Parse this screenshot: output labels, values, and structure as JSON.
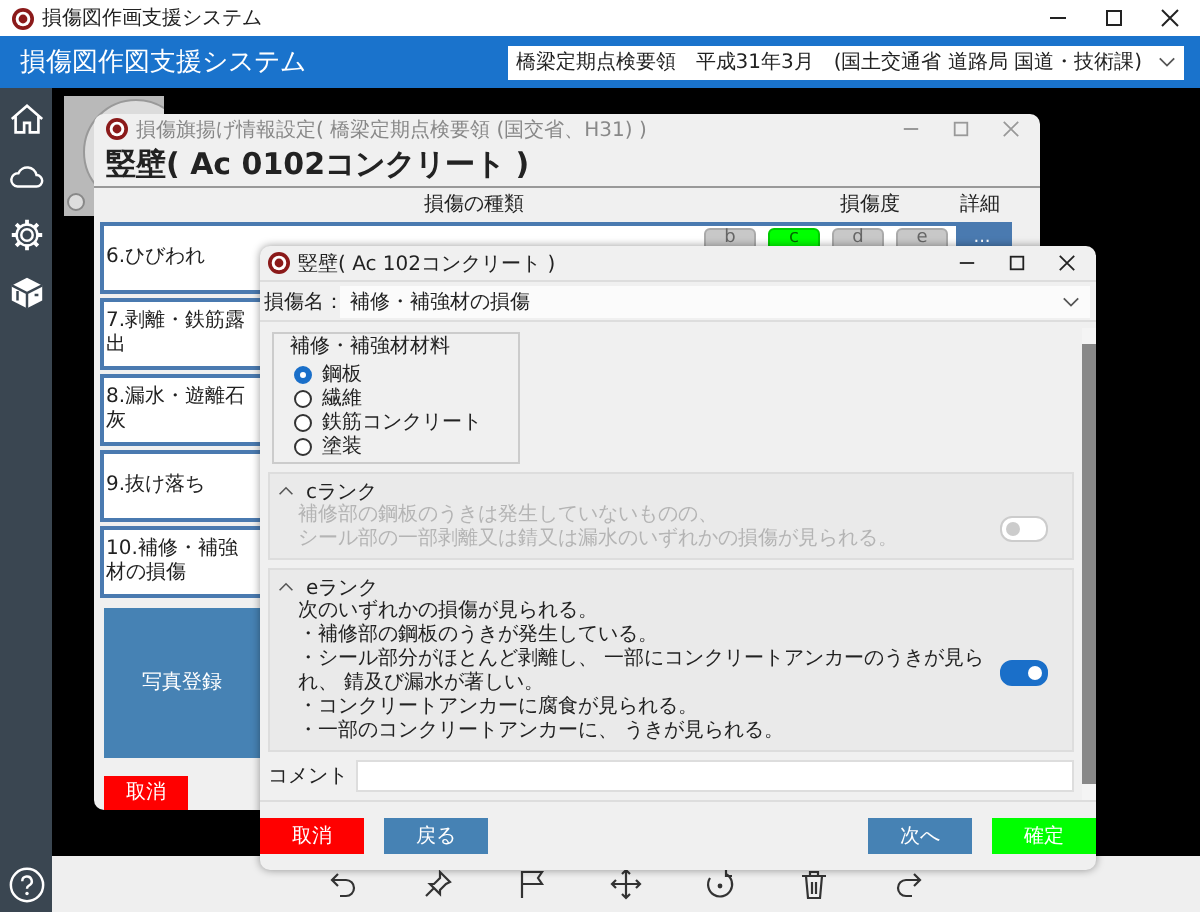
{
  "app_window": {
    "title": "損傷図作画支援システム"
  },
  "header": {
    "title": "損傷図作図支援システム",
    "standard": "橋梁定期点検要領　平成31年3月　(国土交通省 道路局 国道・技術課)"
  },
  "damage_window": {
    "title": "損傷旗揚げ情報設定( 橋梁定期点検要領 (国交省、H31) )",
    "heading": "竪壁( Ac 0102コンクリート )",
    "columns": [
      "損傷の種類",
      "損傷度",
      "詳細"
    ],
    "rows": [
      {
        "label": "6.ひびわれ",
        "ranks": [
          {
            "label": "b",
            "selected": false
          },
          {
            "label": "c",
            "selected": true
          },
          {
            "label": "d",
            "selected": false
          },
          {
            "label": "e",
            "selected": false
          }
        ],
        "detail": "..."
      },
      {
        "label": "7.剥離・鉄筋露出"
      },
      {
        "label": "8.漏水・遊離石灰"
      },
      {
        "label": "9.抜け落ち"
      },
      {
        "label": "10.補修・補強材の損傷"
      }
    ],
    "photo_button": "写真登録",
    "cancel_button": "取消"
  },
  "dialog": {
    "title": "竪壁( Ac  102コンクリート )",
    "damage_name": {
      "label": "損傷名：",
      "value": "補修・補強材の損傷"
    },
    "material": {
      "legend": "補修・補強材材料",
      "options": [
        {
          "label": "鋼板",
          "selected": true
        },
        {
          "label": "繊維",
          "selected": false
        },
        {
          "label": "鉄筋コンクリート",
          "selected": false
        },
        {
          "label": "塗装",
          "selected": false
        }
      ]
    },
    "ranks": [
      {
        "name": "cランク",
        "enabled": false,
        "on": false,
        "lines": [
          "補修部の鋼板のうきは発生していないものの、",
          "シール部の一部剥離又は錆又は漏水のいずれかの損傷が見られる。"
        ]
      },
      {
        "name": "eランク",
        "enabled": true,
        "on": true,
        "lines": [
          "次のいずれかの損傷が見られる。",
          "・補修部の鋼板のうきが発生している。",
          "・シール部分がほとんど剥離し、 一部にコンクリートアンカーのうきが見られ、 錆及び漏水が著しい。",
          "・コンクリートアンカーに腐食が見られる。",
          "・一部のコンクリートアンカーに、 うきが見られる。"
        ]
      }
    ],
    "comment": {
      "label": "コメント"
    },
    "buttons": [
      {
        "kind": "cancel",
        "label": "取消"
      },
      {
        "kind": "back",
        "label": "戻る"
      },
      {
        "kind": "next",
        "label": "次へ"
      },
      {
        "kind": "confirm",
        "label": "確定"
      }
    ]
  }
}
